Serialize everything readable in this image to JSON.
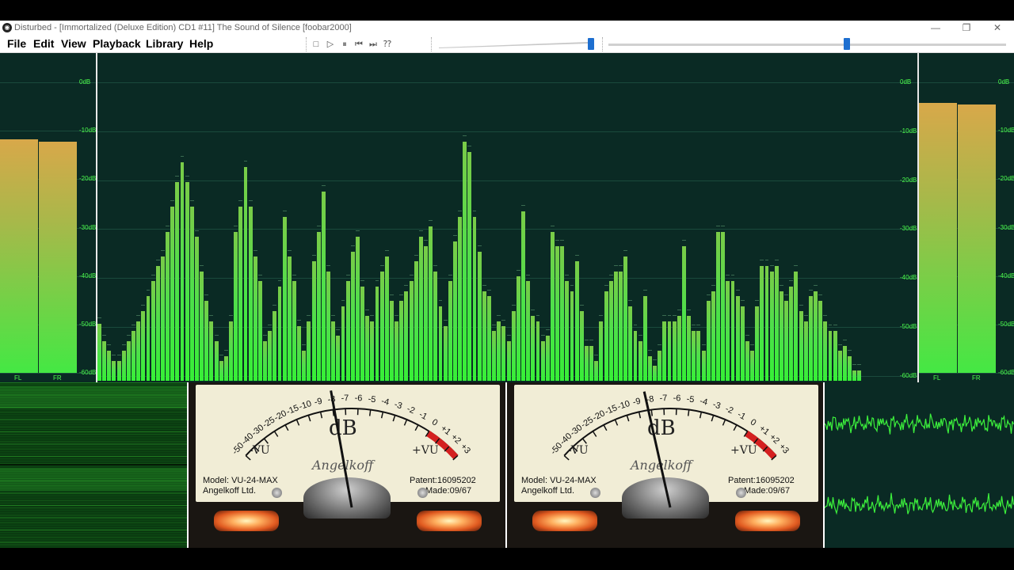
{
  "window": {
    "title": "Disturbed - [Immortalized (Deluxe Edition) CD1 #11] The Sound of Silence  [foobar2000]",
    "app_icon": "foobar-icon",
    "minimize": "—",
    "maximize": "❐",
    "close": "✕"
  },
  "menu": {
    "items": [
      {
        "label": "File"
      },
      {
        "label": "Edit"
      },
      {
        "label": "View"
      },
      {
        "label": "Playback"
      },
      {
        "label": "Library"
      },
      {
        "label": "Help"
      }
    ]
  },
  "toolbar": {
    "buttons": [
      {
        "name": "stop-icon",
        "glyph": "□"
      },
      {
        "name": "play-icon",
        "glyph": "▷"
      },
      {
        "name": "pause-icon",
        "glyph": "⏸"
      },
      {
        "name": "previous-icon",
        "glyph": "⏮"
      },
      {
        "name": "next-icon",
        "glyph": "⏭"
      },
      {
        "name": "random-icon",
        "glyph": "⁇"
      }
    ],
    "volume_level": 1.0,
    "seek_position": 0.6
  },
  "vis": {
    "db_labels": [
      "0dB",
      "-10dB",
      "-20dB",
      "-30dB",
      "-40dB",
      "-50dB",
      "-60dB"
    ],
    "left_meter": {
      "channels": [
        {
          "label": "FL",
          "level_db": -11.8
        },
        {
          "label": "FR",
          "level_db": -12.3
        }
      ]
    },
    "right_meter": {
      "channels": [
        {
          "label": "FL",
          "level_db": -4.2
        },
        {
          "label": "FR",
          "level_db": -4.5
        }
      ]
    },
    "spectrum": {
      "db_min": -60,
      "db_max": 0,
      "bars_db": [
        -48.5,
        -52,
        -54,
        -56,
        -56,
        -54,
        -52,
        -50,
        -48,
        -46,
        -43,
        -40,
        -37,
        -35,
        -30,
        -25,
        -20,
        -16,
        -20,
        -25,
        -31,
        -38,
        -44,
        -48,
        -52,
        -56,
        -55,
        -48,
        -30,
        -25,
        -17,
        -25,
        -35,
        -40,
        -52,
        -50,
        -46,
        -41,
        -27,
        -35,
        -40,
        -49,
        -54,
        -48,
        -36,
        -30,
        -22,
        -38,
        -48,
        -51,
        -45,
        -40,
        -34,
        -31,
        -41,
        -47,
        -48,
        -41,
        -38,
        -35,
        -44,
        -48,
        -44,
        -42,
        -40,
        -36,
        -31,
        -33,
        -29,
        -38,
        -45,
        -49,
        -40,
        -32,
        -27,
        -12,
        -14,
        -27,
        -34,
        -42,
        -43,
        -50,
        -48,
        -49,
        -52,
        -46,
        -39,
        -26,
        -40,
        -47,
        -48,
        -52,
        -51,
        -30,
        -33,
        -33,
        -40,
        -42,
        -36,
        -46,
        -53,
        -53,
        -56,
        -48,
        -42,
        -40,
        -38,
        -38,
        -35,
        -45,
        -50,
        -52,
        -43,
        -55,
        -57,
        -54,
        -48,
        -48,
        -48,
        -47,
        -33,
        -47,
        -50,
        -50,
        -54,
        -44,
        -42,
        -30,
        -30,
        -40,
        -40,
        -43,
        -45,
        -52,
        -54,
        -45,
        -37,
        -37,
        -38,
        -37,
        -42,
        -44,
        -41,
        -38,
        -46,
        -48,
        -43,
        -42,
        -44,
        -48,
        -50,
        -50,
        -54,
        -53,
        -55,
        -58,
        -58,
        -60,
        -60,
        -60
      ]
    }
  },
  "vu_meters": [
    {
      "scale": [
        "-50",
        "-40",
        "-30",
        "-25",
        "-20",
        "-15",
        "-10",
        "-9",
        "-8",
        "-7",
        "-6",
        "-5",
        "-4",
        "-3",
        "-2",
        "-1",
        "0",
        "+1",
        "+2",
        "+3"
      ],
      "unit": "dB",
      "minus_vu": "-VU",
      "plus_vu": "+VU",
      "signature": "Angelkoff",
      "model": "Model: VU-24-MAX",
      "maker": "Angelkoff Ltd.",
      "patent": "Patent:16095202",
      "made": "Made:09/67",
      "needle_db": -8.5
    },
    {
      "scale": [
        "-50",
        "-40",
        "-30",
        "-25",
        "-20",
        "-15",
        "-10",
        "-9",
        "-8",
        "-7",
        "-6",
        "-5",
        "-4",
        "-3",
        "-2",
        "-1",
        "0",
        "+1",
        "+2",
        "+3"
      ],
      "unit": "dB",
      "minus_vu": "-VU",
      "plus_vu": "+VU",
      "signature": "Angelkoff",
      "model": "Model: VU-24-MAX",
      "maker": "Angelkoff Ltd.",
      "patent": "Patent:16095202",
      "made": "Made:09/67",
      "needle_db": -9
    }
  ],
  "colors": {
    "vis_bg": "#0a2a24",
    "bar_green": "#3ef03e",
    "label_green": "#4cff4c",
    "seek_thumb": "#1e6fd0"
  }
}
